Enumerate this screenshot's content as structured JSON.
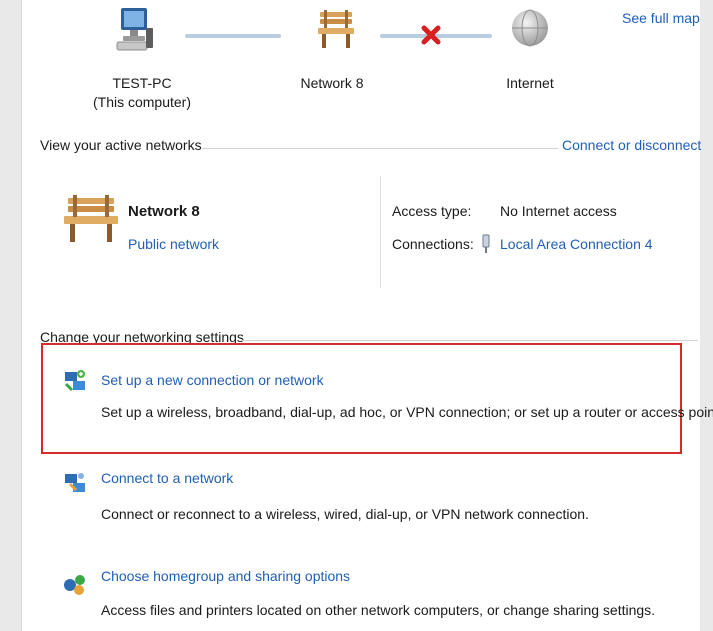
{
  "map": {
    "see_full_map": "See full map",
    "computer": {
      "name": "TEST-PC",
      "subtitle": "(This computer)"
    },
    "network": {
      "name": "Network 8"
    },
    "internet": {
      "name": "Internet"
    },
    "status_icon": "red-x-disconnected"
  },
  "active": {
    "heading": "View your active networks",
    "connect_link": "Connect or disconnect",
    "network_name": "Network 8",
    "network_category": "Public network",
    "access_type_label": "Access type:",
    "access_type_value": "No Internet access",
    "connections_label": "Connections:",
    "connection_name": "Local Area Connection 4"
  },
  "settings": {
    "heading": "Change your networking settings",
    "tasks": [
      {
        "title": "Set up a new connection or network",
        "desc": "Set up a wireless, broadband, dial-up, ad hoc, or VPN connection; or set up a router or access point.",
        "icon": "new-connection-icon"
      },
      {
        "title": "Connect to a network",
        "desc": "Connect or reconnect to a wireless, wired, dial-up, or VPN network connection.",
        "icon": "connect-network-icon"
      },
      {
        "title": "Choose homegroup and sharing options",
        "desc": "Access files and printers located on other network computers, or change sharing settings.",
        "icon": "homegroup-icon"
      }
    ]
  },
  "colors": {
    "link": "#1f5fb5",
    "highlight": "#d62b2b",
    "text": "#1a1a1a"
  }
}
